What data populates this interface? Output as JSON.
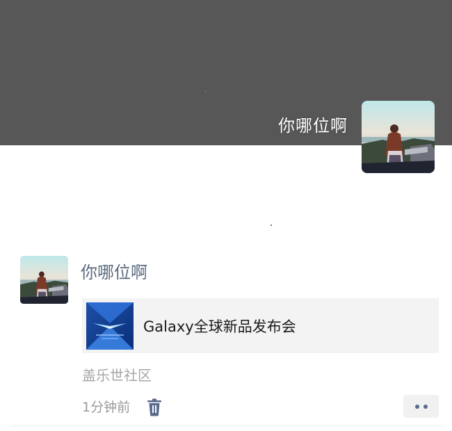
{
  "cover": {
    "user_name": "你哪位啊",
    "background_color": "#575757"
  },
  "post": {
    "author_name": "你哪位啊",
    "shared_link": {
      "title": "Galaxy全球新品发布会",
      "thumbnail_icon": "galaxy-event-thumbnail"
    },
    "source": "盖乐世社区",
    "time": "1分钟前",
    "delete_icon": "trash-icon",
    "more_icon": "more-dots-icon"
  },
  "colors": {
    "name_link": "#5a6a7e",
    "muted_text": "#a6a6a6",
    "card_background": "#f3f3f3",
    "icon_accent": "#5a6a8a"
  }
}
